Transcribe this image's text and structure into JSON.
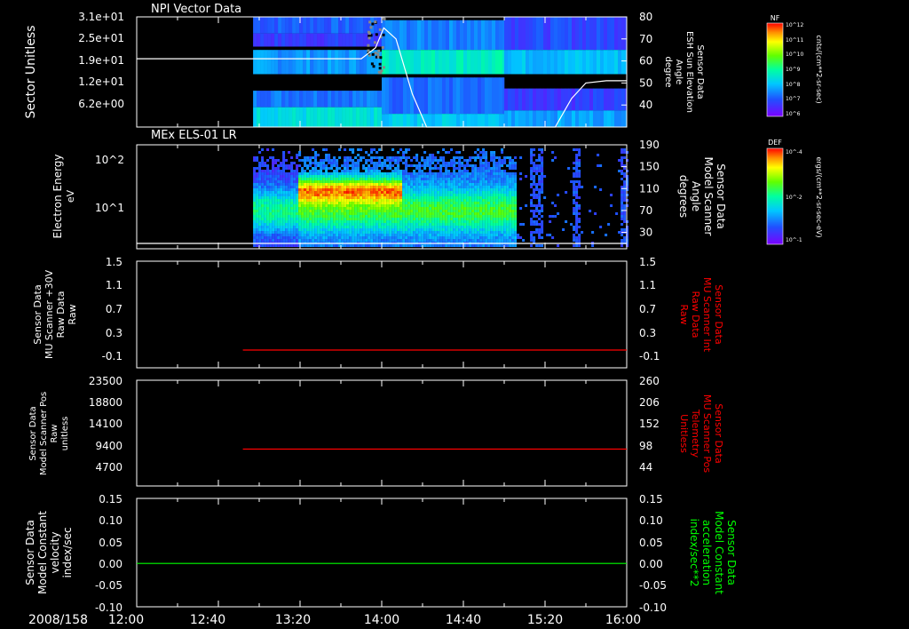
{
  "colors": {
    "background": "#000000",
    "axis": "#ffffff",
    "trace_white": "#ffffff",
    "trace_red": "#ff0000",
    "trace_green": "#00ff00"
  },
  "footer": {
    "date": "2008/158",
    "time_ticks": [
      "12:00",
      "12:40",
      "13:20",
      "14:00",
      "14:40",
      "15:20",
      "16:00"
    ]
  },
  "colorbars": {
    "nf": {
      "tag": "NF",
      "unit": "cnts/(cm**2-sr-sec)",
      "ticks": [
        "10^12",
        "10^11",
        "10^10",
        "10^9",
        "10^8",
        "10^7",
        "10^6"
      ]
    },
    "def": {
      "tag": "DEF",
      "unit": "ergs/(cm**2-sr-sec-eV)",
      "ticks": [
        "10^-4",
        "10^-2",
        "10^-1"
      ]
    }
  },
  "chart_data": [
    {
      "type": "heatmap",
      "title": "NPI Vector Data",
      "ylabel": "Sector Unitless",
      "yticks": [
        "3.1e+01",
        "2.5e+01",
        "1.9e+01",
        "1.2e+01",
        "6.2e+00"
      ],
      "x_range": [
        "12:00",
        "16:00"
      ],
      "data_start": "12:57",
      "bands": [
        {
          "t0": "12:57",
          "t1": "14:00",
          "row0": 0.0,
          "row1": 0.15,
          "level": 0.2
        },
        {
          "t0": "12:57",
          "t1": "14:00",
          "row0": 0.15,
          "row1": 0.27,
          "level": 0.14
        },
        {
          "t0": "12:57",
          "t1": "14:00",
          "row0": 0.3,
          "row1": 0.52,
          "level": 0.28
        },
        {
          "t0": "12:57",
          "t1": "14:00",
          "row0": 0.67,
          "row1": 0.82,
          "level": 0.24
        },
        {
          "t0": "12:57",
          "t1": "14:00",
          "row0": 0.82,
          "row1": 1.0,
          "level": 0.4
        },
        {
          "t0": "14:00",
          "t1": "15:00",
          "row0": 0.03,
          "row1": 0.3,
          "level": 0.25
        },
        {
          "t0": "14:00",
          "t1": "15:00",
          "row0": 0.3,
          "row1": 0.52,
          "level": 0.45
        },
        {
          "t0": "14:00",
          "t1": "15:00",
          "row0": 0.55,
          "row1": 0.88,
          "level": 0.22
        },
        {
          "t0": "14:00",
          "t1": "15:00",
          "row0": 0.88,
          "row1": 1.0,
          "level": 0.36
        },
        {
          "t0": "15:00",
          "t1": "16:00",
          "row0": 0.0,
          "row1": 0.3,
          "level": 0.16
        },
        {
          "t0": "15:00",
          "t1": "16:00",
          "row0": 0.3,
          "row1": 0.52,
          "level": 0.34
        },
        {
          "t0": "15:00",
          "t1": "16:00",
          "row0": 0.65,
          "row1": 0.85,
          "level": 0.14
        },
        {
          "t0": "15:00",
          "t1": "16:00",
          "row0": 0.85,
          "row1": 1.0,
          "level": 0.3
        }
      ],
      "right_axis": {
        "label_lines": [
          "Sensor Data",
          "ESH Sun Elevation",
          "Angle",
          "degree"
        ],
        "ylim": [
          30,
          80
        ],
        "yticks": [
          40,
          50,
          60,
          70,
          80
        ]
      },
      "overlay_line": {
        "color": "#ffffff",
        "x": [
          "12:00",
          "13:50",
          "13:57",
          "14:01",
          "14:07",
          "14:15",
          "14:22",
          "15:25",
          "15:33",
          "15:40",
          "15:50",
          "16:00"
        ],
        "y": [
          61,
          61,
          66,
          75,
          70,
          45,
          30,
          30,
          43,
          50,
          51,
          51
        ]
      }
    },
    {
      "type": "heatmap",
      "title": "MEx ELS-01 LR",
      "ylabel_lines": [
        "Electron Energy",
        "eV"
      ],
      "yticks": [
        "10^2",
        "10^1"
      ],
      "x_range": [
        "12:00",
        "16:00"
      ],
      "data_start": "12:57",
      "right_axis": {
        "label_lines": [
          "Sensor Data",
          "Model Scanner",
          "Angle",
          "degrees"
        ],
        "ylim": [
          0,
          190
        ],
        "yticks": [
          30,
          70,
          110,
          150,
          190
        ]
      },
      "overlay_line": {
        "color": "#ffffff",
        "x": [
          "12:00",
          "16:00"
        ],
        "y": [
          0,
          0
        ]
      }
    },
    {
      "type": "line",
      "left_axis": {
        "label_lines": [
          "Sensor Data",
          "MU Scanner +30V",
          "Raw Data",
          "Raw"
        ],
        "ylim": [
          -0.3,
          1.5
        ],
        "yticks": [
          "1.5",
          "1.1",
          "0.7",
          "0.3",
          "-0.1"
        ]
      },
      "right_axis": {
        "label_lines": [
          "Sensor Data",
          "MU Scanner Int",
          "Raw Data",
          "Raw"
        ],
        "ylim": [
          -0.3,
          1.5
        ],
        "yticks": [
          "1.5",
          "1.1",
          "0.7",
          "0.3",
          "-0.1"
        ]
      },
      "series": [
        {
          "color": "#ff0000",
          "x": [
            "12:52",
            "16:00"
          ],
          "y": [
            0.0,
            0.0
          ]
        }
      ]
    },
    {
      "type": "line",
      "left_axis": {
        "label_lines": [
          "Sensor Data",
          "Model Scanner Pos",
          "Raw",
          "unitless"
        ],
        "ylim": [
          0,
          23500
        ],
        "yticks": [
          "23500",
          "18800",
          "14100",
          "9400",
          "4700"
        ]
      },
      "right_axis": {
        "label_lines": [
          "Sensor Data",
          "MU Scanner Pos",
          "Telemetry",
          "Unitless"
        ],
        "ylim": [
          -10,
          260
        ],
        "yticks": [
          "260",
          "206",
          "152",
          "98",
          "44"
        ]
      },
      "series": [
        {
          "color": "#ff0000",
          "x": [
            "12:52",
            "16:00"
          ],
          "y": [
            8200,
            8200
          ]
        }
      ]
    },
    {
      "type": "line",
      "left_axis": {
        "label_lines": [
          "Sensor Data",
          "Model Constant",
          "velocity",
          "index/sec"
        ],
        "ylim": [
          -0.1,
          0.15
        ],
        "yticks": [
          "0.15",
          "0.10",
          "0.05",
          "0.00",
          "-0.05",
          "-0.10"
        ]
      },
      "right_axis": {
        "label_lines": [
          "Sensor Data",
          "Model Constant",
          "acceleration",
          "index/sec**2"
        ],
        "ylim": [
          -0.1,
          0.15
        ],
        "yticks": [
          "0.15",
          "0.10",
          "0.05",
          "0.00",
          "-0.05",
          "-0.10"
        ]
      },
      "series": [
        {
          "color": "#00ff00",
          "x": [
            "12:00",
            "16:00"
          ],
          "y": [
            0.0,
            0.0
          ]
        }
      ]
    }
  ]
}
